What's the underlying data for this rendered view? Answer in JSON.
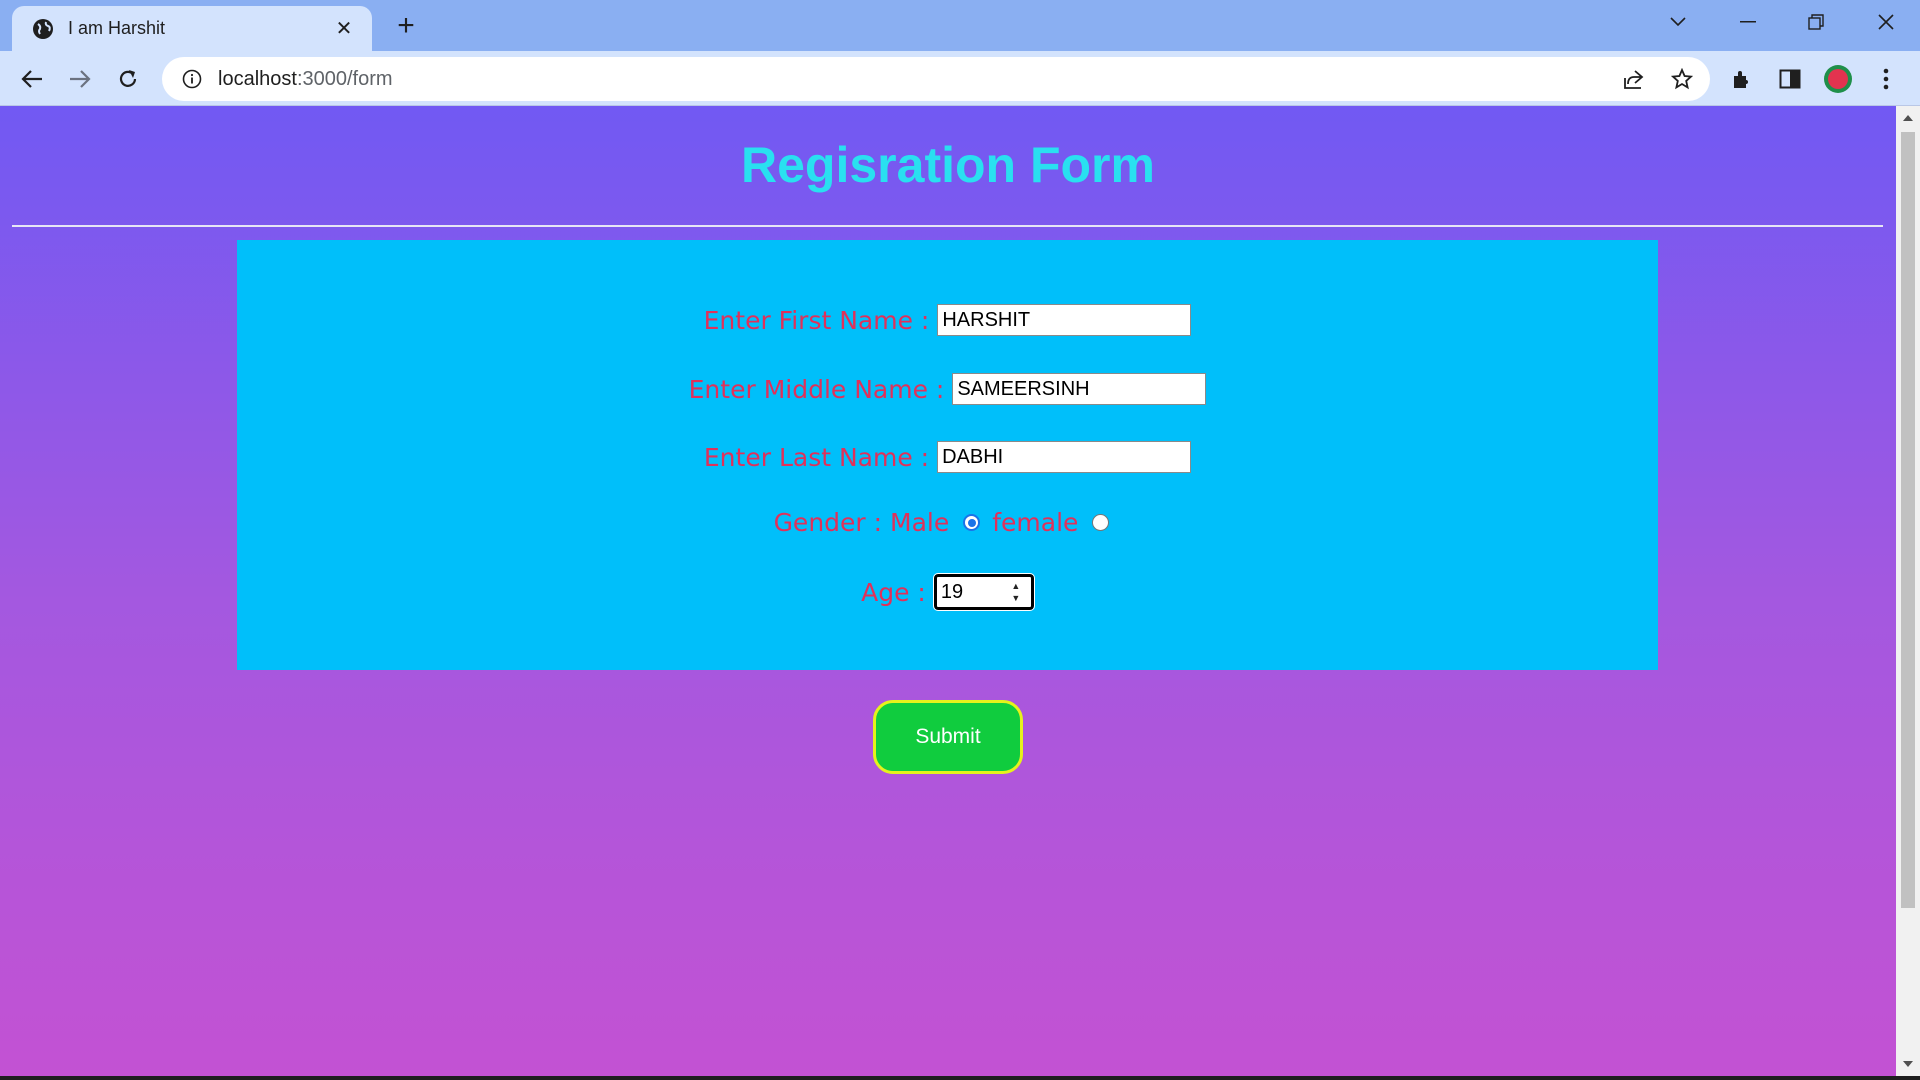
{
  "browser": {
    "tab_title": "I am Harshit",
    "url_host": "localhost",
    "url_path": ":3000/form"
  },
  "page": {
    "title": "Regisration Form",
    "fields": {
      "first_name_label": "Enter First Name :",
      "first_name_value": "HARSHIT",
      "middle_name_label": "Enter Middle Name :",
      "middle_name_value": "SAMEERSINH",
      "last_name_label": "Enter Last Name :",
      "last_name_value": "DABHI",
      "gender_label": "Gender : Male",
      "female_label": "female",
      "gender_selected": "Male",
      "age_label": "Age :",
      "age_value": "19"
    },
    "submit_label": "Submit"
  },
  "colors": {
    "title": "#29e0f0",
    "label": "#e0315a",
    "panel": "#00bffa",
    "submit_bg": "#10cc3e",
    "submit_border": "#e5f21c"
  }
}
